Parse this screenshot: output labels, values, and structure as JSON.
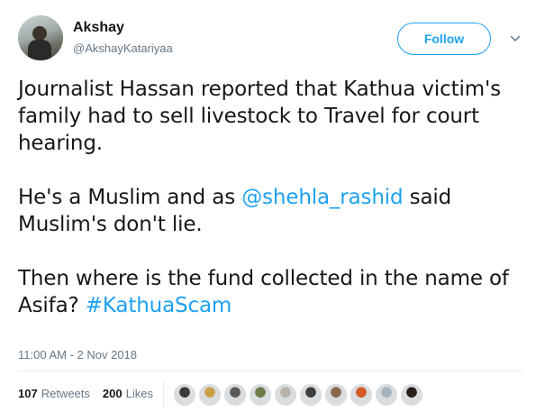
{
  "user": {
    "name": "Akshay",
    "handle": "@AkshayKatariyaa",
    "avatar_icon": "avatar-photo"
  },
  "follow_label": "Follow",
  "tweet": {
    "para1": "Journalist Hassan reported that Kathua victim's family had to sell livestock to Travel for court hearing.",
    "para2_before": "He's a Muslim and as ",
    "para2_mention": "@shehla_rashid",
    "para2_after": " said Muslim's don't lie.",
    "para3_before": "Then where is the fund collected in the name of Asifa? ",
    "para3_hashtag": "#KathuaScam"
  },
  "timestamp": "11:00 AM - 2 Nov 2018",
  "stats": {
    "retweets_count": "107",
    "retweets_label": "Retweets",
    "likes_count": "200",
    "likes_label": "Likes"
  },
  "colors": {
    "accent": "#1da1f2",
    "secondary_text": "#657786",
    "divider": "#e6ecf0"
  },
  "likers": [
    {
      "color": "#3b3a36"
    },
    {
      "color": "#c9a04a"
    },
    {
      "color": "#5a5a5a"
    },
    {
      "color": "#6b7b4a"
    },
    {
      "color": "#b7b2aa"
    },
    {
      "color": "#3d3d3d"
    },
    {
      "color": "#8a6a4a"
    },
    {
      "color": "#d45a2a"
    },
    {
      "color": "#a7b3bd"
    },
    {
      "color": "#2a1e1a"
    }
  ]
}
